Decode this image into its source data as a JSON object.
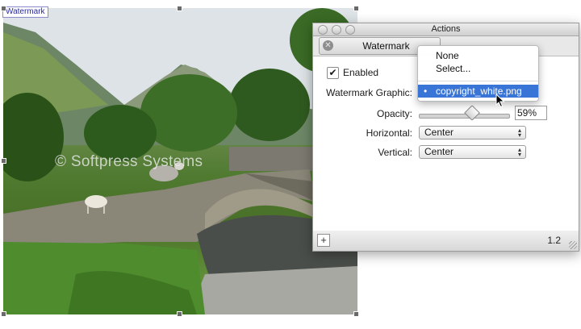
{
  "image": {
    "tag_label": "Watermark",
    "watermark_overlay": "© Softpress Systems"
  },
  "window": {
    "title": "Actions",
    "tab_label": "Watermark",
    "tab_close_icon": "close-icon"
  },
  "form": {
    "enabled_label": "Enabled",
    "enabled_checked": true,
    "graphic_label": "Watermark Graphic:",
    "opacity_label": "Opacity:",
    "opacity_value": "59%",
    "opacity_fraction": 0.59,
    "horizontal_label": "Horizontal:",
    "horizontal_value": "Center",
    "vertical_label": "Vertical:",
    "vertical_value": "Center"
  },
  "menu": {
    "items": [
      "None",
      "Select...",
      "copyright_white.png"
    ],
    "selected": "copyright_white.png"
  },
  "footer": {
    "add_label": "+",
    "version": "1.2"
  },
  "colors": {
    "selection_blue": "#3875d7",
    "tag_border": "#8a8acc"
  }
}
